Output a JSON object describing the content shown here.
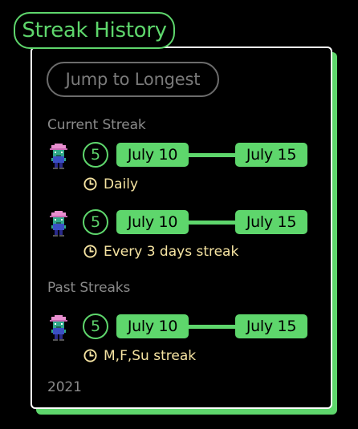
{
  "header": {
    "title": "Streak History"
  },
  "toolbar": {
    "jump_label": "Jump to Longest"
  },
  "sections": {
    "current_label": "Current Streak",
    "past_label": "Past Streaks",
    "year_label": "2021"
  },
  "current_streaks": [
    {
      "count": "5",
      "start": "July 10",
      "end": "July 15",
      "frequency": "Daily"
    },
    {
      "count": "5",
      "start": "July 10",
      "end": "July 15",
      "frequency": "Every 3 days streak"
    }
  ],
  "past_streaks": [
    {
      "count": "5",
      "start": "July 10",
      "end": "July 15",
      "frequency": "M,F,Su streak"
    }
  ],
  "icons": {
    "avatar": "pixel-character-avatar",
    "frequency": "clock-icon"
  },
  "colors": {
    "accent_green": "#5ed66c",
    "frequency_text": "#f6e4a2",
    "muted_text": "#8a8a8a",
    "card_border": "#ffffff",
    "background": "#000000"
  }
}
